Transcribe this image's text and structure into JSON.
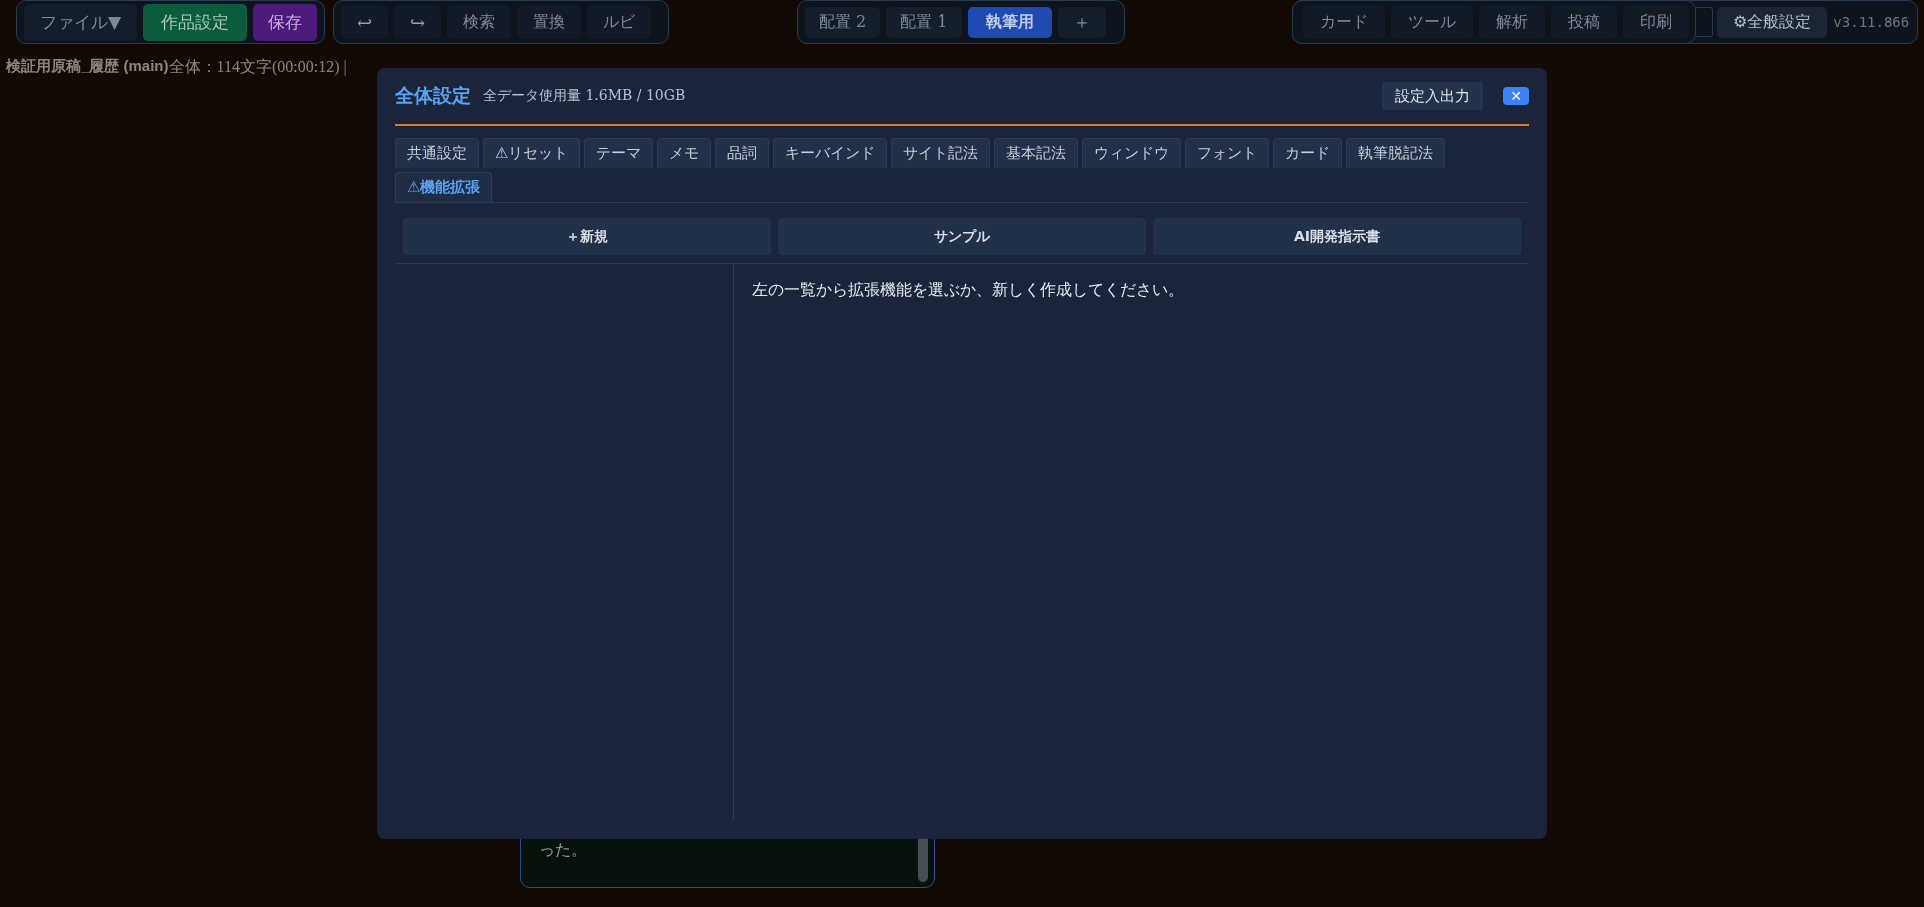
{
  "file_tools": [
    {
      "label": "ファイル▼",
      "kind": "plain"
    },
    {
      "label": "作品設定",
      "kind": "green"
    },
    {
      "label": "保存",
      "kind": "purple"
    }
  ],
  "edit_tools": [
    {
      "label": "↩",
      "kind": "icon"
    },
    {
      "label": "↪",
      "kind": "icon"
    },
    {
      "label": "検索",
      "kind": "plain"
    },
    {
      "label": "置換",
      "kind": "plain"
    },
    {
      "label": "ルビ",
      "kind": "plain"
    }
  ],
  "layout_tabs": [
    {
      "label": "配置 2",
      "selected": false
    },
    {
      "label": "配置 1",
      "selected": false
    },
    {
      "label": "執筆用",
      "selected": true
    }
  ],
  "add_layout": "＋",
  "panel_tools": [
    "カード",
    "ツール",
    "解析",
    "投稿",
    "印刷"
  ],
  "settings_button": "⚙全般設定",
  "version": "v3.11.866",
  "status_line": {
    "document": "検証用原稿_履歴 (main)",
    "stats": "全体：114文字(00:00:12) |"
  },
  "editor": {
    "text": "った。"
  },
  "dialog": {
    "title": "全体設定",
    "usage": "全データ使用量 1.6MB / 10GB",
    "io_button": "設定入出力",
    "close": "✕",
    "tabs": [
      {
        "label": "共通設定",
        "selected": false
      },
      {
        "label": "⚠リセット",
        "selected": false
      },
      {
        "label": "テーマ",
        "selected": false
      },
      {
        "label": "メモ",
        "selected": false
      },
      {
        "label": "品詞",
        "selected": false
      },
      {
        "label": "キーバインド",
        "selected": false
      },
      {
        "label": "サイト記法",
        "selected": false
      },
      {
        "label": "基本記法",
        "selected": false
      },
      {
        "label": "ウィンドウ",
        "selected": false
      },
      {
        "label": "フォント",
        "selected": false
      },
      {
        "label": "カード",
        "selected": false
      },
      {
        "label": "執筆脱記法",
        "selected": false
      },
      {
        "label": "⚠機能拡張",
        "selected": true
      }
    ],
    "actions": [
      "＋新規",
      "サンプル",
      "AI開発指示書"
    ],
    "message": "左の一覧から拡張機能を選ぶか、新しく作成してください。"
  }
}
